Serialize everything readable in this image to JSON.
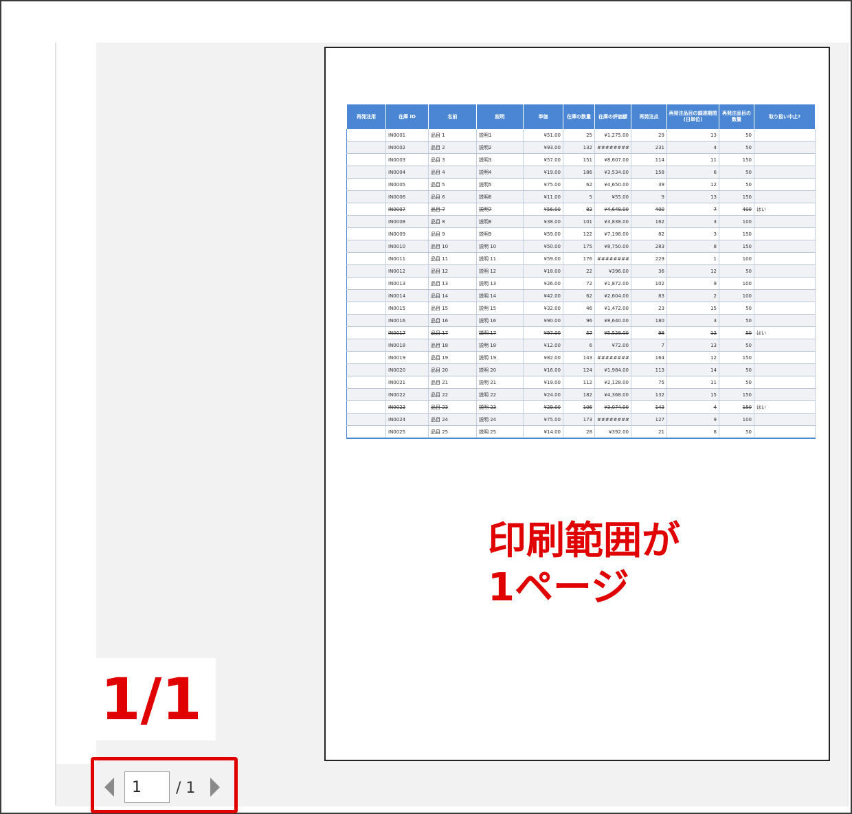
{
  "sheet": {
    "headers": [
      "再発注用",
      "在庫 ID",
      "名前",
      "説明",
      "単価",
      "在庫の数量",
      "在庫の評価額",
      "再発注点",
      "再発注品目の調達期間 (日単位)",
      "再発注品目の数量",
      "取り扱い中止?"
    ],
    "rows": [
      {
        "flag": "",
        "id": "IN0001",
        "name": "品目 1",
        "desc": "説明1",
        "price": "¥51.00",
        "qty": "25",
        "val": "¥1,275.00",
        "reord": "29",
        "days": "13",
        "rqty": "50",
        "stop": ""
      },
      {
        "flag": "",
        "id": "IN0002",
        "name": "品目 2",
        "desc": "説明2",
        "price": "¥93.00",
        "qty": "132",
        "val": "########",
        "reord": "231",
        "days": "4",
        "rqty": "50",
        "stop": ""
      },
      {
        "flag": "",
        "id": "IN0003",
        "name": "品目 3",
        "desc": "説明3",
        "price": "¥57.00",
        "qty": "151",
        "val": "¥8,607.00",
        "reord": "114",
        "days": "11",
        "rqty": "150",
        "stop": ""
      },
      {
        "flag": "",
        "id": "IN0004",
        "name": "品目 4",
        "desc": "説明4",
        "price": "¥19.00",
        "qty": "186",
        "val": "¥3,534.00",
        "reord": "158",
        "days": "6",
        "rqty": "50",
        "stop": ""
      },
      {
        "flag": "",
        "id": "IN0005",
        "name": "品目 5",
        "desc": "説明5",
        "price": "¥75.00",
        "qty": "62",
        "val": "¥4,650.00",
        "reord": "39",
        "days": "12",
        "rqty": "50",
        "stop": ""
      },
      {
        "flag": "",
        "id": "IN0006",
        "name": "品目 6",
        "desc": "説明6",
        "price": "¥11.00",
        "qty": "5",
        "val": "¥55.00",
        "reord": "9",
        "days": "13",
        "rqty": "150",
        "stop": ""
      },
      {
        "flag": "",
        "id": "IN0007",
        "name": "品目 7",
        "desc": "説明7",
        "price": "¥56.00",
        "qty": "82",
        "val": "¥4,648.00",
        "reord": "400",
        "days": "7",
        "rqty": "400",
        "stop": "はい"
      },
      {
        "flag": "",
        "id": "IN0008",
        "name": "品目 8",
        "desc": "説明8",
        "price": "¥38.00",
        "qty": "101",
        "val": "¥3,838.00",
        "reord": "162",
        "days": "3",
        "rqty": "100",
        "stop": ""
      },
      {
        "flag": "",
        "id": "IN0009",
        "name": "品目 9",
        "desc": "説明9",
        "price": "¥59.00",
        "qty": "122",
        "val": "¥7,198.00",
        "reord": "82",
        "days": "3",
        "rqty": "150",
        "stop": ""
      },
      {
        "flag": "",
        "id": "IN0010",
        "name": "品目 10",
        "desc": "説明 10",
        "price": "¥50.00",
        "qty": "175",
        "val": "¥8,750.00",
        "reord": "283",
        "days": "8",
        "rqty": "150",
        "stop": ""
      },
      {
        "flag": "",
        "id": "IN0011",
        "name": "品目 11",
        "desc": "説明 11",
        "price": "¥59.00",
        "qty": "176",
        "val": "########",
        "reord": "229",
        "days": "1",
        "rqty": "100",
        "stop": ""
      },
      {
        "flag": "",
        "id": "IN0012",
        "name": "品目 12",
        "desc": "説明 12",
        "price": "¥18.00",
        "qty": "22",
        "val": "¥396.00",
        "reord": "36",
        "days": "12",
        "rqty": "50",
        "stop": ""
      },
      {
        "flag": "",
        "id": "IN0013",
        "name": "品目 13",
        "desc": "説明 13",
        "price": "¥26.00",
        "qty": "72",
        "val": "¥1,872.00",
        "reord": "102",
        "days": "9",
        "rqty": "100",
        "stop": ""
      },
      {
        "flag": "",
        "id": "IN0014",
        "name": "品目 14",
        "desc": "説明 14",
        "price": "¥42.00",
        "qty": "62",
        "val": "¥2,604.00",
        "reord": "83",
        "days": "2",
        "rqty": "100",
        "stop": ""
      },
      {
        "flag": "",
        "id": "IN0015",
        "name": "品目 15",
        "desc": "説明 15",
        "price": "¥32.00",
        "qty": "46",
        "val": "¥1,472.00",
        "reord": "23",
        "days": "15",
        "rqty": "50",
        "stop": ""
      },
      {
        "flag": "",
        "id": "IN0016",
        "name": "品目 16",
        "desc": "説明 16",
        "price": "¥90.00",
        "qty": "96",
        "val": "¥8,640.00",
        "reord": "180",
        "days": "3",
        "rqty": "50",
        "stop": ""
      },
      {
        "flag": "",
        "id": "IN0017",
        "name": "品目 17",
        "desc": "説明 17",
        "price": "¥97.00",
        "qty": "57",
        "val": "¥5,529.00",
        "reord": "98",
        "days": "12",
        "rqty": "50",
        "stop": "はい"
      },
      {
        "flag": "",
        "id": "IN0018",
        "name": "品目 18",
        "desc": "説明 18",
        "price": "¥12.00",
        "qty": "6",
        "val": "¥72.00",
        "reord": "7",
        "days": "13",
        "rqty": "50",
        "stop": ""
      },
      {
        "flag": "",
        "id": "IN0019",
        "name": "品目 19",
        "desc": "説明 19",
        "price": "¥82.00",
        "qty": "143",
        "val": "########",
        "reord": "164",
        "days": "12",
        "rqty": "150",
        "stop": ""
      },
      {
        "flag": "",
        "id": "IN0020",
        "name": "品目 20",
        "desc": "説明 20",
        "price": "¥16.00",
        "qty": "124",
        "val": "¥1,984.00",
        "reord": "113",
        "days": "14",
        "rqty": "50",
        "stop": ""
      },
      {
        "flag": "",
        "id": "IN0021",
        "name": "品目 21",
        "desc": "説明 21",
        "price": "¥19.00",
        "qty": "112",
        "val": "¥2,128.00",
        "reord": "75",
        "days": "11",
        "rqty": "50",
        "stop": ""
      },
      {
        "flag": "",
        "id": "IN0022",
        "name": "品目 22",
        "desc": "説明 22",
        "price": "¥24.00",
        "qty": "182",
        "val": "¥4,368.00",
        "reord": "132",
        "days": "15",
        "rqty": "150",
        "stop": ""
      },
      {
        "flag": "",
        "id": "IN0023",
        "name": "品目 23",
        "desc": "説明 23",
        "price": "¥29.00",
        "qty": "106",
        "val": "¥3,074.00",
        "reord": "143",
        "days": "4",
        "rqty": "150",
        "stop": "はい"
      },
      {
        "flag": "",
        "id": "IN0024",
        "name": "品目 24",
        "desc": "説明 24",
        "price": "¥75.00",
        "qty": "173",
        "val": "########",
        "reord": "127",
        "days": "9",
        "rqty": "100",
        "stop": ""
      },
      {
        "flag": "",
        "id": "IN0025",
        "name": "品目 25",
        "desc": "説明 25",
        "price": "¥14.00",
        "qty": "28",
        "val": "¥392.00",
        "reord": "21",
        "days": "8",
        "rqty": "50",
        "stop": ""
      }
    ]
  },
  "annotation": {
    "print_range_line1": "印刷範囲が",
    "print_range_line2": "1ページ",
    "page_count": "1/1"
  },
  "pager": {
    "current_page": "1",
    "total_label": "/ 1"
  },
  "colors": {
    "header_blue": "#4a86d4",
    "annotation_red": "#e00000"
  }
}
